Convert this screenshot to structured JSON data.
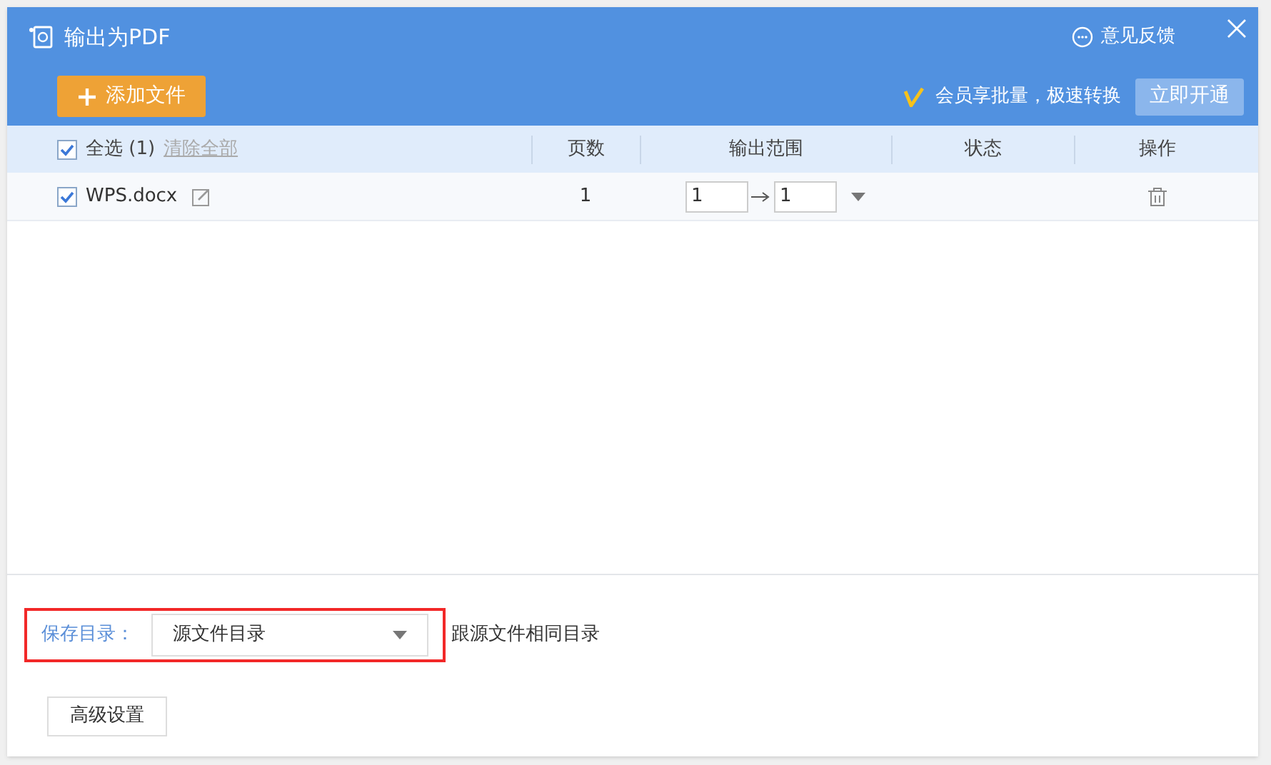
{
  "window": {
    "title": "输出为PDF",
    "feedback": "意见反馈"
  },
  "toolbar": {
    "add_button": "添加文件",
    "promo": "会员享批量，极速转换",
    "upgrade_button": "立即开通"
  },
  "table": {
    "select_all": {
      "label": "全选 (1)",
      "checked": true
    },
    "clear_link": "清除全部",
    "columns": [
      "页数",
      "输出范围",
      "状态",
      "操作"
    ],
    "rows": [
      {
        "name": "WPS.docx",
        "checked": true,
        "pages": "1",
        "range_from": "1",
        "range_to": "1"
      }
    ]
  },
  "save": {
    "label": "保存目录：",
    "value": "源文件目录",
    "hint": "跟源文件相同目录",
    "highlighted": true
  },
  "advanced_button": "高级设置"
}
